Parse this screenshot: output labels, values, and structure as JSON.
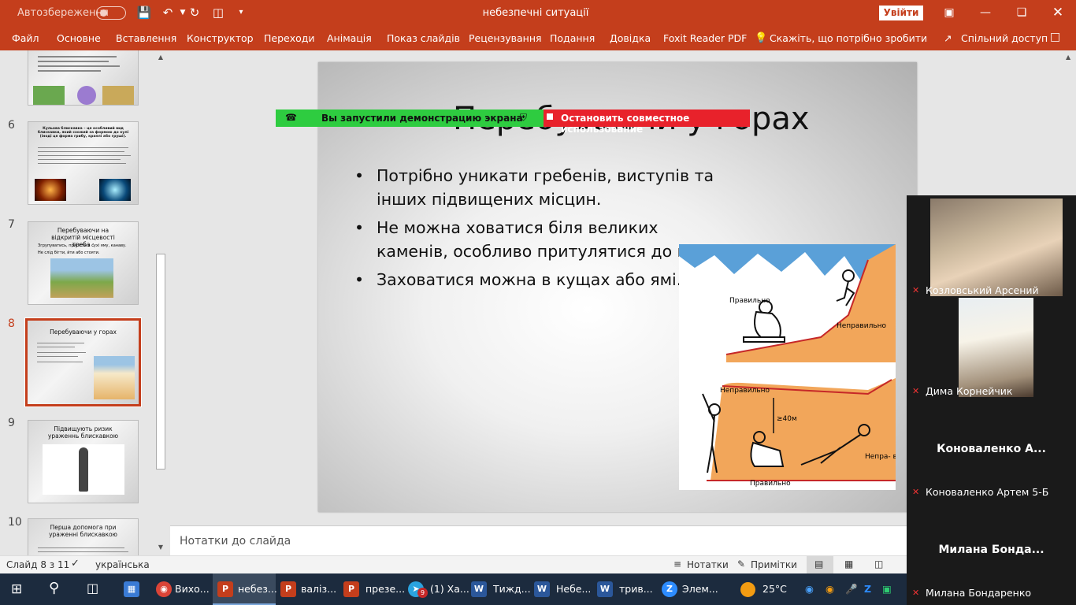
{
  "titlebar": {
    "autosave": "Автозбереження",
    "document": "небезпечні ситуації",
    "signin": "Увійти"
  },
  "ribbon": {
    "tabs": [
      "Файл",
      "Основне",
      "Вставлення",
      "Конструктор",
      "Переходи",
      "Анімація",
      "Показ слайдів",
      "Рецензування",
      "Подання",
      "Довідка",
      "Foxit Reader PDF"
    ],
    "tell_me": "Скажіть, що потрібно зробити",
    "share": "Спільний доступ"
  },
  "thumbnails": {
    "slide6": {
      "num": "6",
      "title": "Кульова блискавка – це особливий вид блискавки, який схожий за формою до кулі (іноді ця форма грибу, краплі або груші)."
    },
    "slide7": {
      "num": "7",
      "title": "Перебуваючи на відкритій місцевості треба :",
      "b1": "Згрупуватись, присісти в сухі яму, канаву.",
      "b2": "Не слід бігти, йти або стояти."
    },
    "slide8": {
      "num": "8",
      "title": "Перебуваючи у горах"
    },
    "slide9": {
      "num": "9",
      "title": "Підвищують ризик ураженнь блискавкою"
    },
    "slide10": {
      "num": "10",
      "title": "Перша допомога при ураженні блискавкою"
    }
  },
  "slide": {
    "title": "Перебуваючи у горах",
    "bullets": [
      "Потрібно уникати гребенів, виступів та інших підвищених місцин.",
      "Не можна ховатися біля великих каменів, особливо притулятися до них.",
      "Заховатися можна в кущах або ямі."
    ],
    "picture_labels": {
      "right": "Правильно",
      "wrong": "Неправильно",
      "wrong2": "Неправильно",
      "height": "≥40м",
      "wrong3": "Непра-\nвильно",
      "right2": "Правильно"
    }
  },
  "share_banner": {
    "green_text": "Вы запустили демонстрацию экрана",
    "red_text": "Остановить совместное использование",
    "green_color": "#2ecc40",
    "red_color": "#e8222b"
  },
  "notes": {
    "placeholder": "Нотатки до слайда"
  },
  "statusbar": {
    "slide_info": "Слайд 8 з 11",
    "language": "українська",
    "notes": "Нотатки",
    "comments": "Примітки"
  },
  "videos": [
    {
      "name": "Козловський Арсений"
    },
    {
      "name": "Дима Корнейчик"
    },
    {
      "big": "Коноваленко  А...",
      "name": "Коноваленко Артем 5-Б"
    },
    {
      "big": "Милана  Бонда...",
      "name": "Милана Бондаренко"
    }
  ],
  "taskbar": {
    "items": [
      "Вихо...",
      "небез...",
      "валіз...",
      "презе...",
      "(1) Ха...",
      "Тижд...",
      "Небе...",
      "трив...",
      "Элем..."
    ],
    "telegram_badge": "9",
    "temperature": "25°C"
  },
  "colors": {
    "accent": "#c43e1c",
    "taskbar": "#1c2b3e"
  }
}
